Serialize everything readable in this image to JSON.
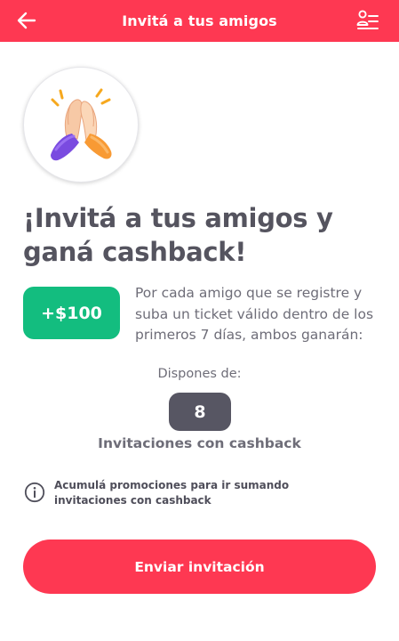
{
  "header": {
    "title": "Invitá a tus amigos",
    "back_icon": "arrow-left-icon",
    "menu_icon": "user-list-icon",
    "color": "#fe3852"
  },
  "hero": {
    "illustration": "high-five-hands-icon"
  },
  "headline": "¡Invitá a tus amigos y ganá cashback!",
  "reward": {
    "amount": "+$100",
    "color": "#13bd7f",
    "description": "Por cada amigo que se registre y suba un ticket válido dentro de los primeros 7 días, ambos ganarán:"
  },
  "availability": {
    "label": "Dispones de:",
    "count": "8",
    "unit_label": "Invitaciones con cashback"
  },
  "info": {
    "icon": "info-icon",
    "text": "Acumulá promociones para ir sumando invitaciones con cashback"
  },
  "cta": {
    "label": "Enviar invitación",
    "color": "#fe3852"
  }
}
